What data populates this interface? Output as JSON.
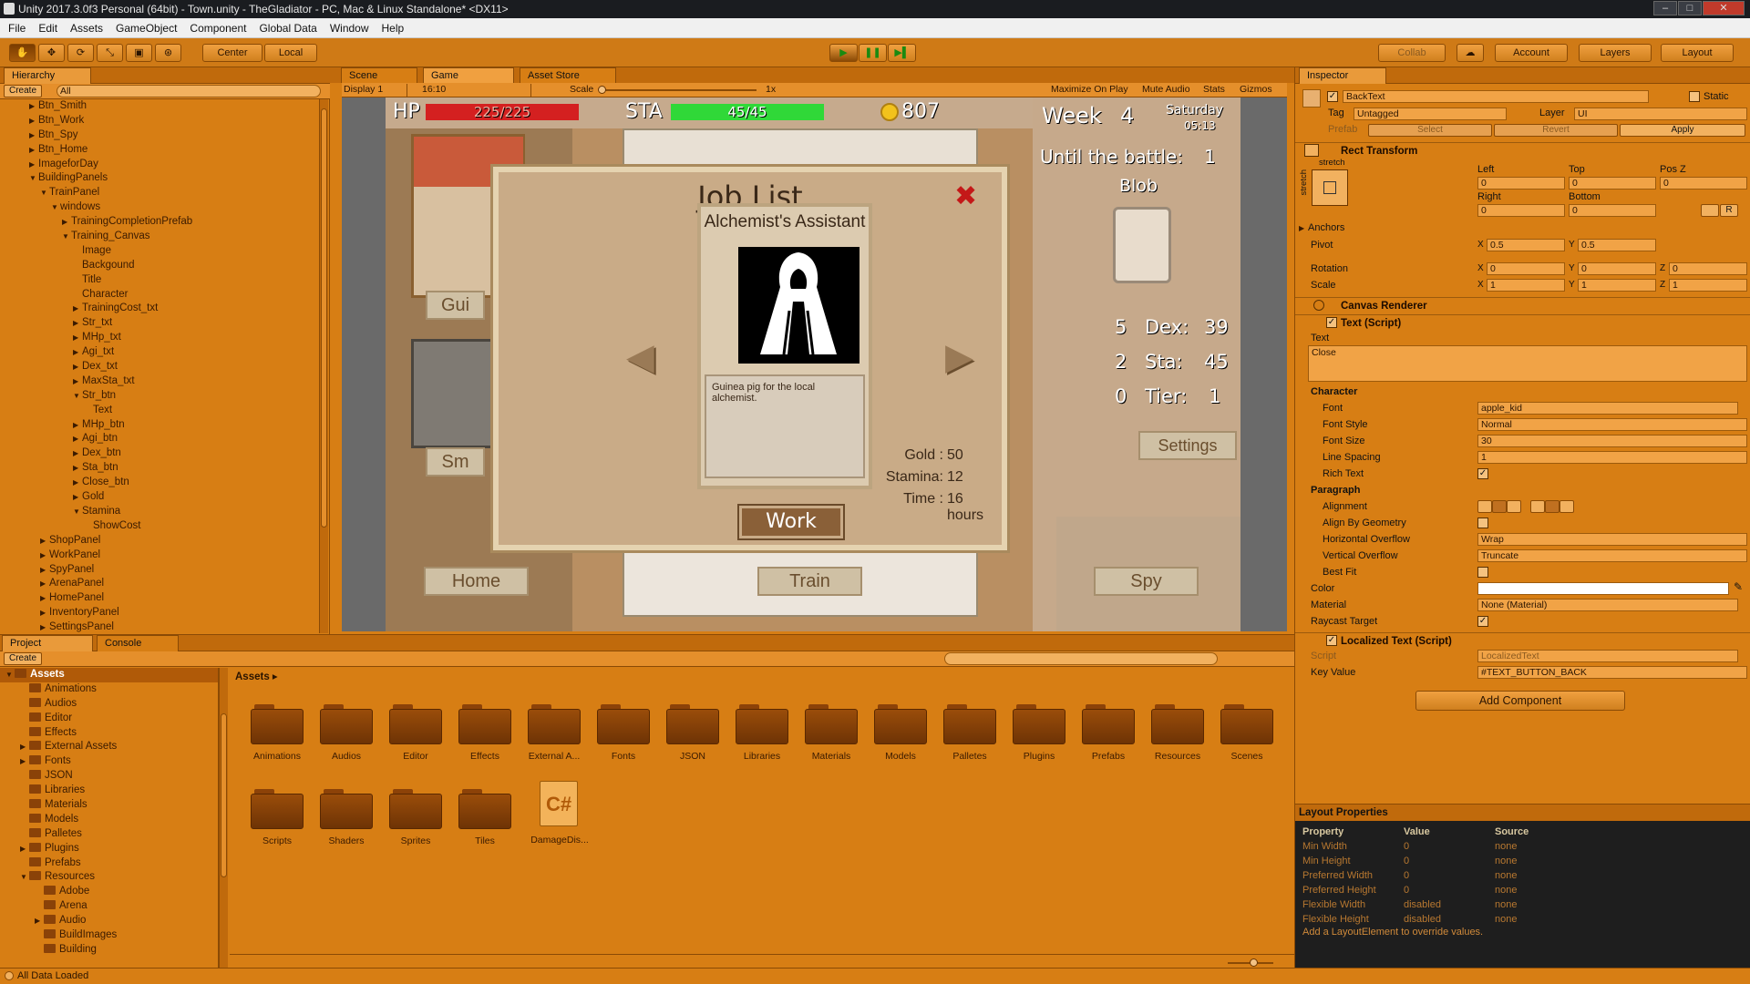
{
  "window": {
    "title": "Unity 2017.3.0f3 Personal (64bit) - Town.unity - TheGladiator - PC, Mac & Linux Standalone* <DX11>",
    "min": "–",
    "max": "□",
    "close": "✕"
  },
  "menu": [
    "File",
    "Edit",
    "Assets",
    "GameObject",
    "Component",
    "Global Data",
    "Window",
    "Help"
  ],
  "toolbar": {
    "tools": [
      "✋",
      "✥",
      "⟳",
      "⤡",
      "▣",
      "⊛"
    ],
    "pivot": "Center",
    "space": "Local",
    "play": "▶",
    "pause": "❚❚",
    "step": "▶▌",
    "collab": "Collab",
    "cloud": "☁",
    "account": "Account",
    "layers": "Layers",
    "layout": "Layout"
  },
  "hierarchy": {
    "tab": "Hierarchy",
    "create": "Create",
    "search": "All",
    "items": [
      {
        "t": "Btn_Smith",
        "d": 1,
        "a": "▶"
      },
      {
        "t": "Btn_Work",
        "d": 1,
        "a": "▶"
      },
      {
        "t": "Btn_Spy",
        "d": 1,
        "a": "▶"
      },
      {
        "t": "Btn_Home",
        "d": 1,
        "a": "▶"
      },
      {
        "t": "ImageforDay",
        "d": 1,
        "a": "▶"
      },
      {
        "t": "BuildingPanels",
        "d": 1,
        "a": "▼"
      },
      {
        "t": "TrainPanel",
        "d": 2,
        "a": "▼"
      },
      {
        "t": "windows",
        "d": 3,
        "a": "▼"
      },
      {
        "t": "TrainingCompletionPrefab",
        "d": 4,
        "a": "▶"
      },
      {
        "t": "Training_Canvas",
        "d": 4,
        "a": "▼"
      },
      {
        "t": "Image",
        "d": 5,
        "a": ""
      },
      {
        "t": "Backgound",
        "d": 5,
        "a": ""
      },
      {
        "t": "Title",
        "d": 5,
        "a": ""
      },
      {
        "t": "Character",
        "d": 5,
        "a": ""
      },
      {
        "t": "TrainingCost_txt",
        "d": 5,
        "a": "▶"
      },
      {
        "t": "Str_txt",
        "d": 5,
        "a": "▶"
      },
      {
        "t": "MHp_txt",
        "d": 5,
        "a": "▶"
      },
      {
        "t": "Agi_txt",
        "d": 5,
        "a": "▶"
      },
      {
        "t": "Dex_txt",
        "d": 5,
        "a": "▶"
      },
      {
        "t": "MaxSta_txt",
        "d": 5,
        "a": "▶"
      },
      {
        "t": "Str_btn",
        "d": 5,
        "a": "▼"
      },
      {
        "t": "Text",
        "d": 6,
        "a": ""
      },
      {
        "t": "MHp_btn",
        "d": 5,
        "a": "▶"
      },
      {
        "t": "Agi_btn",
        "d": 5,
        "a": "▶"
      },
      {
        "t": "Dex_btn",
        "d": 5,
        "a": "▶"
      },
      {
        "t": "Sta_btn",
        "d": 5,
        "a": "▶"
      },
      {
        "t": "Close_btn",
        "d": 5,
        "a": "▶"
      },
      {
        "t": "Gold",
        "d": 5,
        "a": "▶"
      },
      {
        "t": "Stamina",
        "d": 5,
        "a": "▼"
      },
      {
        "t": "ShowCost",
        "d": 6,
        "a": ""
      },
      {
        "t": "ShopPanel",
        "d": 2,
        "a": "▶"
      },
      {
        "t": "WorkPanel",
        "d": 2,
        "a": "▶"
      },
      {
        "t": "SpyPanel",
        "d": 2,
        "a": "▶"
      },
      {
        "t": "ArenaPanel",
        "d": 2,
        "a": "▶"
      },
      {
        "t": "HomePanel",
        "d": 2,
        "a": "▶"
      },
      {
        "t": "InventoryPanel",
        "d": 2,
        "a": "▶"
      },
      {
        "t": "SettingsPanel",
        "d": 2,
        "a": "▶"
      }
    ]
  },
  "viewtabs": {
    "scene": "Scene",
    "game": "Game",
    "store": "Asset Store"
  },
  "gamebar": {
    "display": "Display 1",
    "aspect": "16:10",
    "scale_label": "Scale",
    "scale_value": "1x",
    "maximize": "Maximize On Play",
    "mute": "Mute Audio",
    "stats": "Stats",
    "gizmos": "Gizmos"
  },
  "game": {
    "hp_label": "HP",
    "hp_value": "225/225",
    "hp_fill": 1.0,
    "sta_label": "STA",
    "sta_value": "45/45",
    "sta_fill": 1.0,
    "gold": "807",
    "week_label": "Week",
    "week_num": "4",
    "day": "Saturday",
    "time": "05:13",
    "until": "Until the battle:",
    "until_num": "1",
    "enemy": "Blob",
    "stat1": "5",
    "dex_label": "Dex:",
    "dex": "39",
    "stat2": "2",
    "sta_lbl": "Sta:",
    "sta2": "45",
    "stat3": "0",
    "tier_label": "Tier:",
    "tier": "1",
    "settings": "Settings",
    "btn_gui": "Gui",
    "btn_sm": "Sm",
    "home": "Home",
    "train": "Train",
    "spy": "Spy",
    "dialog": {
      "title": "Job List",
      "job": "Alchemist's Assistant",
      "desc": "Guinea pig for the local alchemist.",
      "gold_label": "Gold :",
      "gold": "50",
      "stamina_label": "Stamina:",
      "stamina": "12",
      "time_label": "Time :",
      "time": "16 hours",
      "work": "Work",
      "close": "✖",
      "prev": "◀",
      "next": "▶"
    }
  },
  "project": {
    "tab": "Project",
    "console": "Console",
    "create": "Create",
    "root": "Assets",
    "tree": [
      {
        "t": "Assets",
        "d": 0,
        "a": "▼"
      },
      {
        "t": "Animations",
        "d": 1,
        "a": ""
      },
      {
        "t": "Audios",
        "d": 1,
        "a": ""
      },
      {
        "t": "Editor",
        "d": 1,
        "a": ""
      },
      {
        "t": "Effects",
        "d": 1,
        "a": ""
      },
      {
        "t": "External Assets",
        "d": 1,
        "a": "▶"
      },
      {
        "t": "Fonts",
        "d": 1,
        "a": "▶"
      },
      {
        "t": "JSON",
        "d": 1,
        "a": ""
      },
      {
        "t": "Libraries",
        "d": 1,
        "a": ""
      },
      {
        "t": "Materials",
        "d": 1,
        "a": ""
      },
      {
        "t": "Models",
        "d": 1,
        "a": ""
      },
      {
        "t": "Palletes",
        "d": 1,
        "a": ""
      },
      {
        "t": "Plugins",
        "d": 1,
        "a": "▶"
      },
      {
        "t": "Prefabs",
        "d": 1,
        "a": ""
      },
      {
        "t": "Resources",
        "d": 1,
        "a": "▼"
      },
      {
        "t": "Adobe",
        "d": 2,
        "a": ""
      },
      {
        "t": "Arena",
        "d": 2,
        "a": ""
      },
      {
        "t": "Audio",
        "d": 2,
        "a": "▶"
      },
      {
        "t": "BuildImages",
        "d": 2,
        "a": ""
      },
      {
        "t": "Building",
        "d": 2,
        "a": ""
      }
    ],
    "breadcrumb": "Assets ▸",
    "folders_row1": [
      "Animations",
      "Audios",
      "Editor",
      "Effects",
      "External A...",
      "Fonts",
      "JSON",
      "Libraries",
      "Materials",
      "Models",
      "Palletes",
      "Plugins",
      "Prefabs",
      "Resources",
      "Scenes"
    ],
    "folders_row2": [
      "Scripts",
      "Shaders",
      "Sprites",
      "Tiles"
    ],
    "script_file": "DamageDis...",
    "script_icon": "C#"
  },
  "inspector": {
    "tab": "Inspector",
    "name": "BackText",
    "static": "Static",
    "tag_label": "Tag",
    "tag": "Untagged",
    "layer_label": "Layer",
    "layer": "UI",
    "prefab": "Prefab",
    "select": "Select",
    "revert": "Revert",
    "apply": "Apply",
    "rect": {
      "title": "Rect Transform",
      "stretch": "stretch",
      "stretch_v": "stretch",
      "left_label": "Left",
      "top_label": "Top",
      "posz_label": "Pos Z",
      "left": "0",
      "top": "0",
      "posz": "0",
      "right_label": "Right",
      "bottom_label": "Bottom",
      "right": "0",
      "bottom": "0",
      "r_btn": "R",
      "anchors": "Anchors",
      "pivot": "Pivot",
      "pivot_x": "0.5",
      "pivot_y": "0.5",
      "rotation": "Rotation",
      "rot_x": "0",
      "rot_y": "0",
      "rot_z": "0",
      "scale": "Scale",
      "scale_x": "1",
      "scale_y": "1",
      "scale_z": "1"
    },
    "canvas_renderer": "Canvas Renderer",
    "text": {
      "title": "Text (Script)",
      "text_label": "Text",
      "text": "Close",
      "character": "Character",
      "font_label": "Font",
      "font": "apple_kid",
      "font_style_label": "Font Style",
      "font_style": "Normal",
      "font_size_label": "Font Size",
      "font_size": "30",
      "line_spacing_label": "Line Spacing",
      "line_spacing": "1",
      "rich_label": "Rich Text",
      "paragraph": "Paragraph",
      "alignment_label": "Alignment",
      "align_geo_label": "Align By Geometry",
      "hover_label": "Horizontal Overflow",
      "hover": "Wrap",
      "vover_label": "Vertical Overflow",
      "vover": "Truncate",
      "bestfit_label": "Best Fit",
      "color_label": "Color",
      "material_label": "Material",
      "material": "None (Material)",
      "raycast_label": "Raycast Target"
    },
    "localized": {
      "title": "Localized Text (Script)",
      "script_label": "Script",
      "script": "LocalizedText",
      "key_label": "Key Value",
      "key": "#TEXT_BUTTON_BACK"
    },
    "add_component": "Add Component",
    "layout_props": {
      "title": "Layout Properties",
      "h_prop": "Property",
      "h_val": "Value",
      "h_src": "Source",
      "rows": [
        [
          "Min Width",
          "0",
          "none"
        ],
        [
          "Min Height",
          "0",
          "none"
        ],
        [
          "Preferred Width",
          "0",
          "none"
        ],
        [
          "Preferred Height",
          "0",
          "none"
        ],
        [
          "Flexible Width",
          "disabled",
          "none"
        ],
        [
          "Flexible Height",
          "disabled",
          "none"
        ]
      ],
      "hint": "Add a LayoutElement to override values."
    }
  },
  "status": {
    "text": "All Data Loaded"
  }
}
